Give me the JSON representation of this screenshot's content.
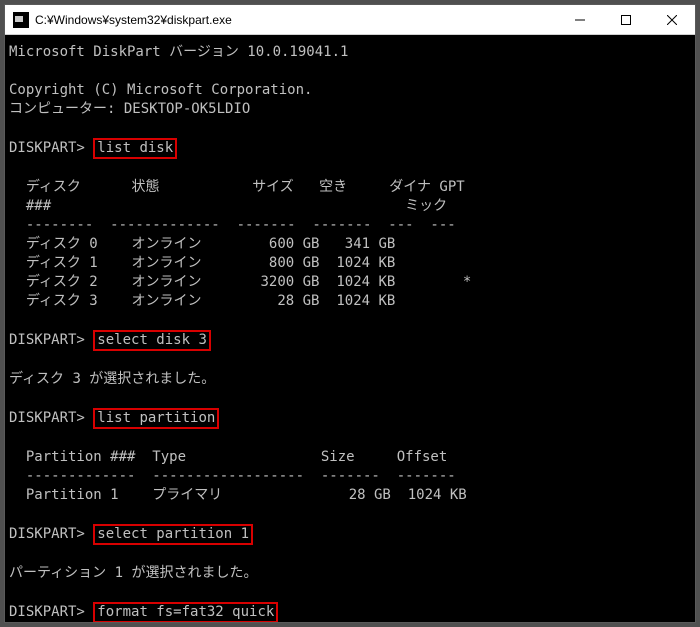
{
  "window": {
    "title": "C:¥Windows¥system32¥diskpart.exe"
  },
  "console": {
    "version_line": "Microsoft DiskPart バージョン 10.0.19041.1",
    "copyright_line": "Copyright (C) Microsoft Corporation.",
    "computer_line": "コンピューター: DESKTOP-OK5LDIO",
    "prompt": "DISKPART>",
    "cmd1": "list disk",
    "disk_header": {
      "disk_col": "ディスク",
      "num_col": "###",
      "status_col": "状態",
      "size_col": "サイズ",
      "free_col": "空き",
      "dyn_col1": "ダイナ",
      "dyn_col2": "ミック",
      "gpt_col": "GPT"
    },
    "disk_divider": "  --------  -------------  -------  -------  ---  ---",
    "disks": [
      {
        "name": "ディスク 0",
        "status": "オンライン",
        "size": "600 GB",
        "free": "341 GB",
        "gpt": ""
      },
      {
        "name": "ディスク 1",
        "status": "オンライン",
        "size": "800 GB",
        "free": "1024 KB",
        "gpt": ""
      },
      {
        "name": "ディスク 2",
        "status": "オンライン",
        "size": "3200 GB",
        "free": "1024 KB",
        "gpt": "*"
      },
      {
        "name": "ディスク 3",
        "status": "オンライン",
        "size": "28 GB",
        "free": "1024 KB",
        "gpt": ""
      }
    ],
    "cmd2": "select disk 3",
    "msg_disk_selected": "ディスク 3 が選択されました。",
    "cmd3": "list partition",
    "part_header": "  Partition ###  Type                Size     Offset",
    "part_divider": "  -------------  ------------------  -------  -------",
    "partitions": [
      {
        "row": "  Partition 1    プライマリ               28 GB  1024 KB"
      }
    ],
    "cmd4": "select partition 1",
    "msg_part_selected": "パーティション 1 が選択されました。",
    "cmd5": "format fs=fat32 quick"
  }
}
